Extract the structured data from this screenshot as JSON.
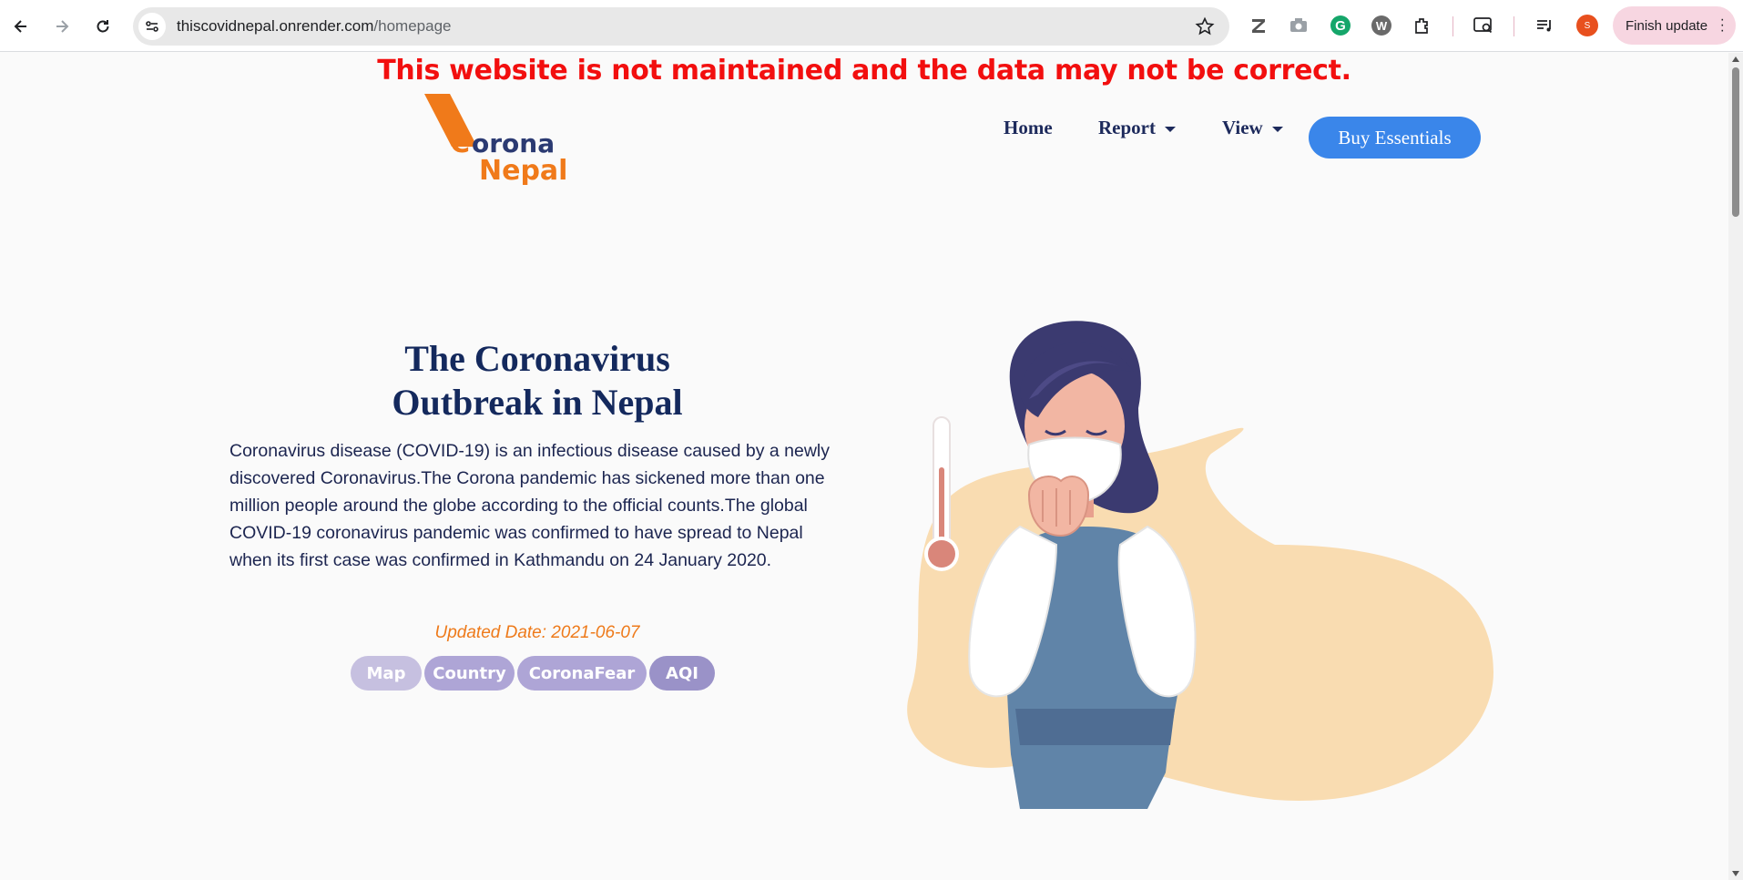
{
  "browser": {
    "url_host": "thiscovidnepal.onrender.com",
    "url_path": "/homepage",
    "profile_initial": "S",
    "finish_update_label": "Finish update",
    "icons": [
      "back-arrow-icon",
      "forward-arrow-icon",
      "reload-icon",
      "site-info-icon",
      "star-icon",
      "zotero-icon",
      "camera-icon",
      "grammarly-icon",
      "wordtune-icon",
      "extensions-icon",
      "search-tab-icon",
      "reading-list-icon",
      "more-menu-icon"
    ]
  },
  "page": {
    "warning": "This website is not maintained and the data may not be correct.",
    "logo": {
      "line1": "Corona",
      "line2": "Nepal"
    },
    "nav": {
      "home": "Home",
      "report": "Report",
      "view": "View",
      "buy": "Buy Essentials"
    },
    "hero": {
      "title_line1": "The Coronavirus",
      "title_line2": "Outbreak in Nepal",
      "text": "Coronavirus disease (COVID-19) is an infectious disease caused by a newly discovered Coronavirus.The Corona pandemic has sickened more than one million people around the globe according to the official counts.The global COVID-19 coronavirus pandemic was confirmed to have spread to Nepal when its first case was confirmed in Kathmandu on 24 January 2020.",
      "updated": "Updated Date: 2021-06-07",
      "pills": [
        "Map",
        "Country",
        "CoronaFear",
        "AQI"
      ]
    }
  },
  "colors": {
    "warning": "#f20f0f",
    "nav_text": "#1d2a5c",
    "buy_button": "#3a86ea",
    "updated_date": "#ee7a1a",
    "pill_map": "#c6c0e0",
    "pill_country": "#aea5d6",
    "pill_coronafear": "#aea5d6",
    "pill_aqi": "#9a92c8"
  }
}
